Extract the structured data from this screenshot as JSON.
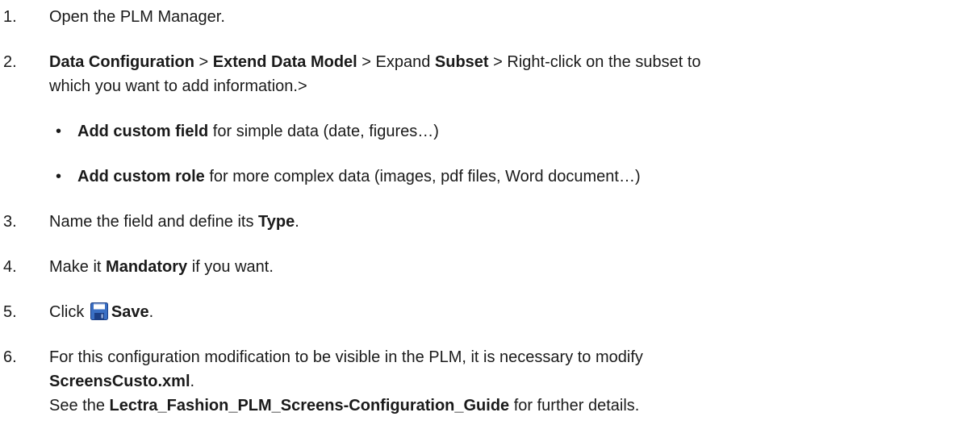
{
  "steps": [
    {
      "number": "1.",
      "text": "Open the PLM Manager."
    },
    {
      "number": "2.",
      "part1_bold": "Data Configuration",
      "sep1": " > ",
      "part2_bold": "Extend Data Model",
      "sep2": " > Expand ",
      "part3_bold": "Subset",
      "sep3": " > Right-click on the subset to",
      "line2": "which you want to add information.>"
    },
    {
      "bullet": "•",
      "bold": "Add custom field",
      "rest": " for simple data (date, figures…)"
    },
    {
      "bullet": "•",
      "bold": "Add custom role",
      "rest": " for more complex data (images, pdf files, Word document…)"
    },
    {
      "number": "3.",
      "pre": "Name the field and define its ",
      "bold": "Type",
      "post": "."
    },
    {
      "number": "4.",
      "pre": "Make it ",
      "bold": "Mandatory",
      "post": " if you want."
    },
    {
      "number": "5.",
      "pre": "Click ",
      "icon": "floppy-save-icon",
      "bold": "Save",
      "post": "."
    },
    {
      "number": "6.",
      "line1": "For this configuration modification to be visible in the PLM, it is necessary to modify",
      "line2_bold": "ScreensCusto.xml",
      "line2_post": ".",
      "line3_pre": "See the ",
      "line3_bold": "Lectra_Fashion_PLM_Screens-Configuration_Guide",
      "line3_post": " for further details."
    }
  ],
  "colors": {
    "text": "#1a1a1a",
    "icon_blue": "#3a6fc4",
    "icon_dark": "#1c3f86"
  }
}
